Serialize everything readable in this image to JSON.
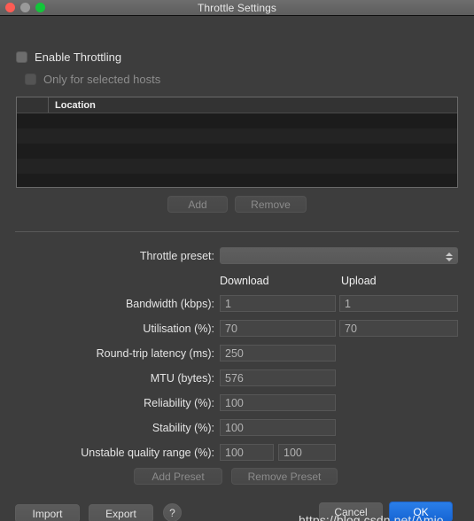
{
  "window": {
    "title": "Throttle Settings",
    "traffic_lights": [
      "close-red",
      "minimize-gray",
      "zoom-green"
    ]
  },
  "checkboxes": [
    {
      "label": "Enable Throttling",
      "checked": false,
      "enabled": true
    },
    {
      "label": "Only for selected hosts",
      "checked": false,
      "enabled": false
    }
  ],
  "hosts_table": {
    "columns": [
      "",
      "Location"
    ],
    "rows": []
  },
  "table_buttons": {
    "add": "Add",
    "remove": "Remove"
  },
  "preset": {
    "label": "Throttle preset:",
    "value": "",
    "stepper_icon": "updown-stepper-icon"
  },
  "columns": {
    "download": "Download",
    "upload": "Upload"
  },
  "fields": [
    {
      "label": "Bandwidth (kbps):",
      "download": "1",
      "upload": "1"
    },
    {
      "label": "Utilisation (%):",
      "download": "70",
      "upload": "70"
    },
    {
      "label": "Round-trip latency (ms):",
      "download": "250",
      "upload": null
    },
    {
      "label": "MTU (bytes):",
      "download": "576",
      "upload": null
    },
    {
      "label": "Reliability (%):",
      "download": "100",
      "upload": null
    },
    {
      "label": "Stability (%):",
      "download": "100",
      "upload": null
    },
    {
      "label": "Unstable quality range (%):",
      "download": "100",
      "upload": "100"
    }
  ],
  "preset_buttons": {
    "add_preset": "Add Preset",
    "remove_preset": "Remove Preset"
  },
  "footer": {
    "import": "Import",
    "export": "Export",
    "help": "?",
    "cancel": "Cancel",
    "ok": "OK"
  },
  "watermark": "https://blog.csdn.net/Amio_",
  "colors": {
    "accent": "#1e6fd9",
    "window_bg": "#3d3d3d",
    "titlebar": "#646464",
    "table_bg": "#1d1d1d",
    "close": "#fc5c54",
    "minimize": "#9a9a9a",
    "zoom": "#13c53a"
  }
}
